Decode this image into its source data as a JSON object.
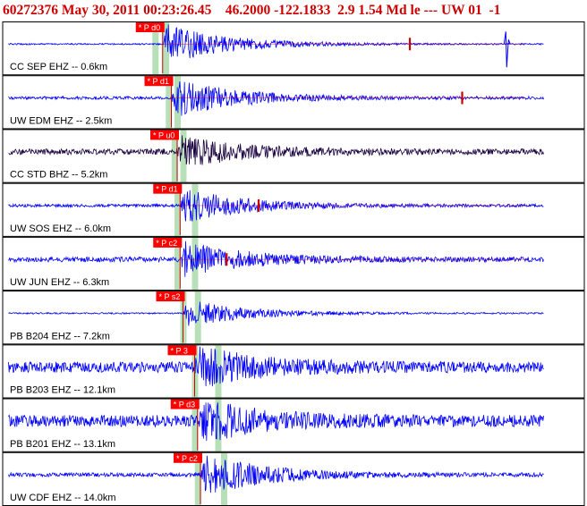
{
  "header": {
    "event_id": "60272376",
    "datetime": "May 30, 2011 00:23:26.45",
    "lat": "46.2000",
    "lon": "-122.1833",
    "depth": "2.9",
    "magnitude": "1.54",
    "mag_type": "Md",
    "flag": "le",
    "dashes": "---",
    "network": "UW",
    "version": "01",
    "trailer": "-1"
  },
  "colors": {
    "header_text": "#cc0000",
    "trace": "#0000ff",
    "trace_dark": "#1a0040",
    "pick_box": "#ff0000",
    "pick_label_text": "#ffffff",
    "pick_line": "#cc0000",
    "window_band": "#b8e0b8",
    "frame": "#000000"
  },
  "chart_data": {
    "type": "line",
    "description_free": true,
    "panels": [
      {
        "label": "CC SEP EHZ -- 0.6km",
        "pick": "P d0",
        "pick_t": 0.275,
        "wave_start": 0.0,
        "wave_end": 1.0,
        "amp": 0.9,
        "noise": 0.03,
        "bands": [
          0.262,
          0.28
        ],
        "dark": false,
        "red_tail": true,
        "extras": [
          {
            "t": 0.7,
            "kind": "red-tick"
          },
          {
            "t": 0.865,
            "kind": "spike"
          }
        ]
      },
      {
        "label": "UW EDM EHZ -- 2.5km",
        "pick": "P d1",
        "pick_t": 0.29,
        "wave_start": 0.0,
        "wave_end": 1.0,
        "amp": 0.85,
        "noise": 0.06,
        "bands": [
          0.285,
          0.3
        ],
        "dark": false,
        "red_tail": true,
        "extras": [
          {
            "t": 0.79,
            "kind": "red-tick"
          }
        ]
      },
      {
        "label": "CC STD BHZ -- 5.2km",
        "pick": "P u0",
        "pick_t": 0.3,
        "wave_start": 0.0,
        "wave_end": 1.0,
        "amp": 0.7,
        "noise": 0.12,
        "bands": [
          0.295,
          0.31
        ],
        "dark": true,
        "red_tail": false,
        "extras": []
      },
      {
        "label": "UW SOS EHZ -- 6.0km",
        "pick": "P d1",
        "pick_t": 0.305,
        "wave_start": 0.0,
        "wave_end": 1.0,
        "amp": 0.75,
        "noise": 0.06,
        "bands": [
          0.3,
          0.33
        ],
        "dark": false,
        "red_tail": true,
        "extras": [
          {
            "t": 0.44,
            "kind": "red-tick"
          }
        ]
      },
      {
        "label": "UW JUN EHZ -- 6.3km",
        "pick": "P c2",
        "pick_t": 0.305,
        "wave_start": 0.0,
        "wave_end": 1.0,
        "amp": 0.75,
        "noise": 0.1,
        "bands": [
          0.3,
          0.33
        ],
        "dark": false,
        "red_tail": true,
        "extras": [
          {
            "t": 0.385,
            "kind": "red-tick"
          }
        ]
      },
      {
        "label": "PB B204 EHZ -- 7.2km",
        "pick": "P s2",
        "pick_t": 0.31,
        "wave_start": 0.0,
        "wave_end": 1.0,
        "amp": 0.6,
        "noise": 0.03,
        "bands": [
          0.31,
          0.335
        ],
        "dark": false,
        "red_tail": false,
        "extras": []
      },
      {
        "label": "PB B203 EHZ -- 12.1km",
        "pick": "P 3",
        "pick_t": 0.33,
        "wave_start": 0.0,
        "wave_end": 1.0,
        "amp": 0.8,
        "noise": 0.22,
        "bands": [
          0.33,
          0.37
        ],
        "dark": false,
        "red_tail": false,
        "extras": []
      },
      {
        "label": "PB B201 EHZ -- 13.1km",
        "pick": "P d3",
        "pick_t": 0.335,
        "wave_start": 0.0,
        "wave_end": 1.0,
        "amp": 0.8,
        "noise": 0.24,
        "bands": [
          0.33,
          0.37
        ],
        "dark": false,
        "red_tail": false,
        "extras": []
      },
      {
        "label": "UW CDF EHZ -- 14.0km",
        "pick": "P c2",
        "pick_t": 0.34,
        "wave_start": 0.0,
        "wave_end": 1.0,
        "amp": 0.9,
        "noise": 0.08,
        "bands": [
          0.335,
          0.38
        ],
        "dark": false,
        "red_tail": false,
        "extras": []
      }
    ]
  }
}
